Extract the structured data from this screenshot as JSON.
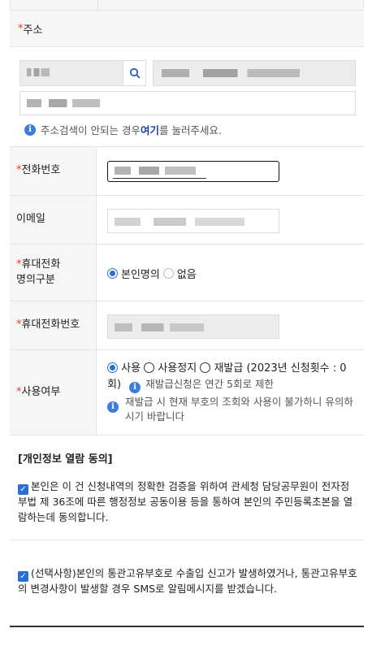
{
  "address": {
    "label": "주소",
    "required_mark": "*",
    "note_prefix": "주소검색이 안되는 경우 ",
    "note_link": "여기",
    "note_suffix": "를 눌러주세요."
  },
  "phone": {
    "label": "전화번호",
    "required_mark": "*"
  },
  "email": {
    "label": "이메일"
  },
  "mobile_type": {
    "label": "휴대전화\n명의구분",
    "required_mark": "*",
    "options": [
      "본인명의",
      "없음"
    ],
    "selected": "본인명의"
  },
  "mobile_number": {
    "label": "휴대전화번호",
    "required_mark": "*"
  },
  "usage": {
    "label": "사용여부",
    "required_mark": "*",
    "opt_use": "사용",
    "opt_stop": "사용정지",
    "opt_reissue": "재발급 (2023년 신청횟수 : 0회)",
    "selected": "사용",
    "note1": "재발급신청은 연간 5회로 제한",
    "note2": "재발급 시 현재 부호의 조회와 사용이 불가하니 유의하시기 바랍니다"
  },
  "consent": {
    "title": "[개인정보 열람 동의]",
    "item1": "본인은 이 건 신청내역의 정확한 검증을 위하여 관세청 담당공무원이 전자정부법 제 36조에 따른 행정정보 공동이용 등을 통하여 본인의 주민등록초본을 열람하는데 동의합니다.",
    "item2": "(선택사항)본인의 통관고유부호로 수출입 신고가 발생하였거나, 통관고유부호의 변경사항이 발생할 경우 SMS로 알림메시지를 받겠습니다."
  },
  "icons": {
    "search": "search-icon",
    "info": "info-icon",
    "check": "checkbox-checked-icon"
  },
  "colors": {
    "required": "#e53b2c",
    "accent": "#2a6ed8",
    "link": "#1a3ea8"
  }
}
